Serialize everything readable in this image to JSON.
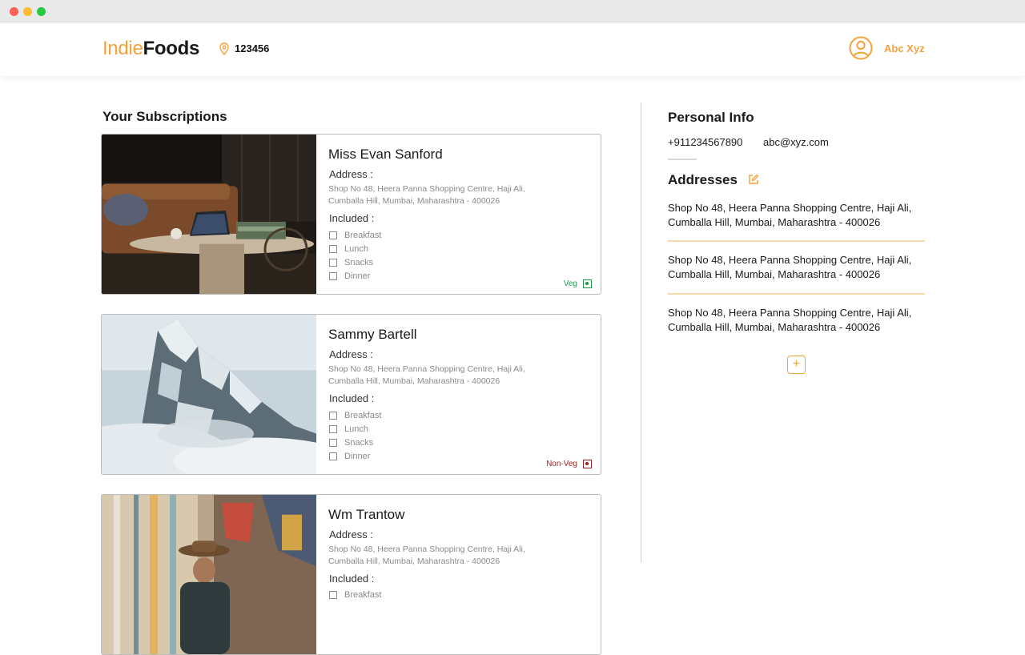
{
  "brand": {
    "part1": "Indie",
    "part2": "Foods"
  },
  "location": {
    "pincode": "123456"
  },
  "user": {
    "name": "Abc Xyz"
  },
  "subscriptions": {
    "title": "Your Subscriptions",
    "address_label": "Address :",
    "included_label": "Included :",
    "items": [
      {
        "name": "Miss Evan Sanford",
        "address_line1": "Shop No 48, Heera Panna Shopping Centre, Haji Ali,",
        "address_line2": "Cumballa Hill, Mumbai, Maharashtra - 400026",
        "meals": [
          "Breakfast",
          "Lunch",
          "Snacks",
          "Dinner"
        ],
        "diet": "Veg"
      },
      {
        "name": "Sammy Bartell",
        "address_line1": "Shop No 48, Heera Panna Shopping Centre, Haji Ali,",
        "address_line2": "Cumballa Hill, Mumbai, Maharashtra - 400026",
        "meals": [
          "Breakfast",
          "Lunch",
          "Snacks",
          "Dinner"
        ],
        "diet": "Non-Veg"
      },
      {
        "name": "Wm Trantow",
        "address_line1": "Shop No 48, Heera Panna Shopping Centre, Haji Ali,",
        "address_line2": "Cumballa Hill, Mumbai, Maharashtra - 400026",
        "meals": [
          "Breakfast"
        ]
      }
    ]
  },
  "personal_info": {
    "title": "Personal Info",
    "phone": "+911234567890",
    "email": "abc@xyz.com"
  },
  "addresses": {
    "title": "Addresses",
    "items": [
      {
        "line1": "Shop No 48, Heera Panna Shopping Centre, Haji Ali,",
        "line2": "Cumballa Hill, Mumbai, Maharashtra - 400026"
      },
      {
        "line1": "Shop No 48, Heera Panna Shopping Centre, Haji Ali,",
        "line2": "Cumballa Hill, Mumbai, Maharashtra - 400026"
      },
      {
        "line1": "Shop No 48, Heera Panna Shopping Centre, Haji Ali,",
        "line2": "Cumballa Hill, Mumbai, Maharashtra - 400026"
      }
    ],
    "add_symbol": "+"
  },
  "colors": {
    "accent": "#f4a23c",
    "veg": "#1c9a4a",
    "non_veg": "#9b2222"
  }
}
